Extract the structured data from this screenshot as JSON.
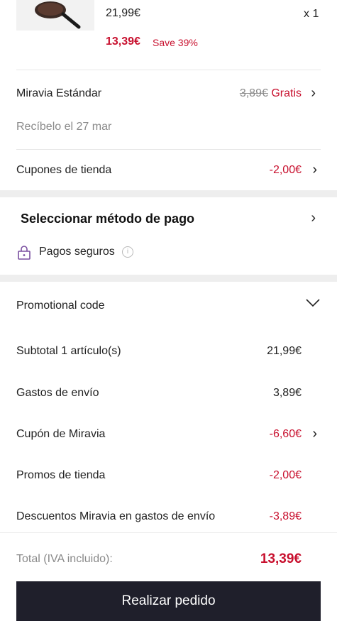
{
  "product": {
    "image_icon": "frying-pan-icon",
    "price_original": "21,99€",
    "quantity": "x 1",
    "price_final": "13,39€",
    "savings": "Save 39%"
  },
  "shipping": {
    "label": "Miravia Estándar",
    "price_old": "3,89€",
    "price_new": "Gratis",
    "delivery": "Recíbelo el 27 mar"
  },
  "store_coupons": {
    "label": "Cupones de tienda",
    "value": "-2,00€"
  },
  "payment": {
    "title": "Seleccionar método de pago",
    "secure_label": "Pagos seguros",
    "icon": "lock-icon",
    "info_icon": "info-icon"
  },
  "summary": {
    "promo_label": "Promotional code",
    "subtotal_label": "Subtotal 1 artículo(s)",
    "subtotal_value": "21,99€",
    "shipping_label": "Gastos de envío",
    "shipping_value": "3,89€",
    "miravia_coupon_label": "Cupón de Miravia",
    "miravia_coupon_value": "-6,60€",
    "store_promos_label": "Promos de tienda",
    "store_promos_value": "-2,00€",
    "shipping_discount_label": "Descuentos Miravia en gastos de envío",
    "shipping_discount_value": "-3,89€"
  },
  "total": {
    "label": "Total (IVA incluido):",
    "value": "13,39€"
  },
  "cta": {
    "label": "Realizar pedido"
  },
  "colors": {
    "accent_red": "#c8102e",
    "button_bg": "#1f1f2b",
    "divider": "#e6e6e6",
    "section_gap": "#eeeeee"
  }
}
